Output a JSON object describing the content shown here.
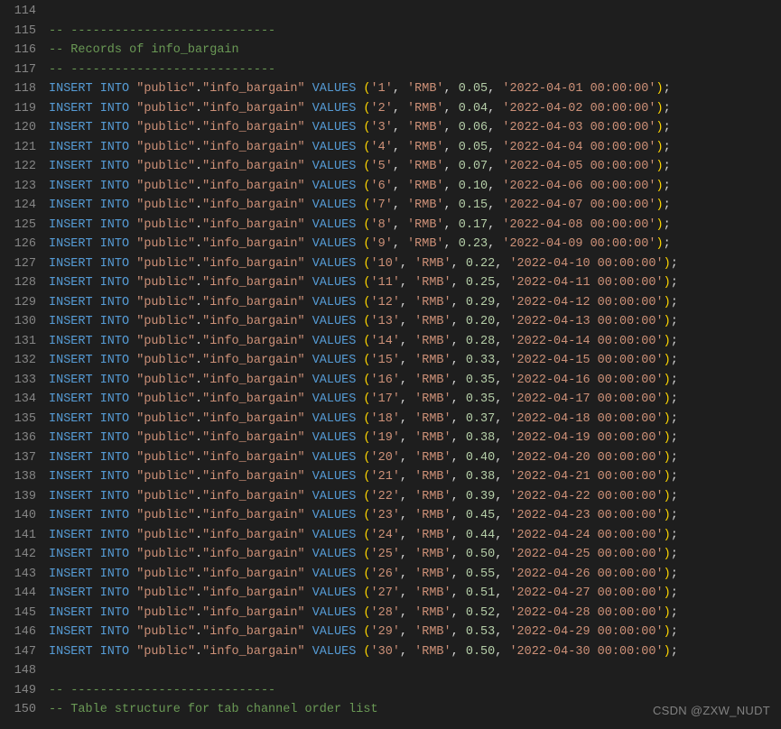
{
  "startLine": 114,
  "dashes": "-- ----------------------------",
  "header": "-- Records of info_bargain",
  "footerDashes": "-- ----------------------------",
  "footer": "-- Table structure for tab channel order list",
  "insert": "INSERT INTO",
  "values": "VALUES",
  "schema": "\"public\"",
  "table": "\"info_bargain\"",
  "rows": [
    {
      "id": "'1'",
      "cur": "'RMB'",
      "val": "0.05",
      "ts": "'2022-04-01 00:00:00'"
    },
    {
      "id": "'2'",
      "cur": "'RMB'",
      "val": "0.04",
      "ts": "'2022-04-02 00:00:00'"
    },
    {
      "id": "'3'",
      "cur": "'RMB'",
      "val": "0.06",
      "ts": "'2022-04-03 00:00:00'"
    },
    {
      "id": "'4'",
      "cur": "'RMB'",
      "val": "0.05",
      "ts": "'2022-04-04 00:00:00'"
    },
    {
      "id": "'5'",
      "cur": "'RMB'",
      "val": "0.07",
      "ts": "'2022-04-05 00:00:00'"
    },
    {
      "id": "'6'",
      "cur": "'RMB'",
      "val": "0.10",
      "ts": "'2022-04-06 00:00:00'"
    },
    {
      "id": "'7'",
      "cur": "'RMB'",
      "val": "0.15",
      "ts": "'2022-04-07 00:00:00'"
    },
    {
      "id": "'8'",
      "cur": "'RMB'",
      "val": "0.17",
      "ts": "'2022-04-08 00:00:00'"
    },
    {
      "id": "'9'",
      "cur": "'RMB'",
      "val": "0.23",
      "ts": "'2022-04-09 00:00:00'"
    },
    {
      "id": "'10'",
      "cur": "'RMB'",
      "val": "0.22",
      "ts": "'2022-04-10 00:00:00'"
    },
    {
      "id": "'11'",
      "cur": "'RMB'",
      "val": "0.25",
      "ts": "'2022-04-11 00:00:00'"
    },
    {
      "id": "'12'",
      "cur": "'RMB'",
      "val": "0.29",
      "ts": "'2022-04-12 00:00:00'"
    },
    {
      "id": "'13'",
      "cur": "'RMB'",
      "val": "0.20",
      "ts": "'2022-04-13 00:00:00'"
    },
    {
      "id": "'14'",
      "cur": "'RMB'",
      "val": "0.28",
      "ts": "'2022-04-14 00:00:00'"
    },
    {
      "id": "'15'",
      "cur": "'RMB'",
      "val": "0.33",
      "ts": "'2022-04-15 00:00:00'"
    },
    {
      "id": "'16'",
      "cur": "'RMB'",
      "val": "0.35",
      "ts": "'2022-04-16 00:00:00'"
    },
    {
      "id": "'17'",
      "cur": "'RMB'",
      "val": "0.35",
      "ts": "'2022-04-17 00:00:00'"
    },
    {
      "id": "'18'",
      "cur": "'RMB'",
      "val": "0.37",
      "ts": "'2022-04-18 00:00:00'"
    },
    {
      "id": "'19'",
      "cur": "'RMB'",
      "val": "0.38",
      "ts": "'2022-04-19 00:00:00'"
    },
    {
      "id": "'20'",
      "cur": "'RMB'",
      "val": "0.40",
      "ts": "'2022-04-20 00:00:00'"
    },
    {
      "id": "'21'",
      "cur": "'RMB'",
      "val": "0.38",
      "ts": "'2022-04-21 00:00:00'"
    },
    {
      "id": "'22'",
      "cur": "'RMB'",
      "val": "0.39",
      "ts": "'2022-04-22 00:00:00'"
    },
    {
      "id": "'23'",
      "cur": "'RMB'",
      "val": "0.45",
      "ts": "'2022-04-23 00:00:00'"
    },
    {
      "id": "'24'",
      "cur": "'RMB'",
      "val": "0.44",
      "ts": "'2022-04-24 00:00:00'"
    },
    {
      "id": "'25'",
      "cur": "'RMB'",
      "val": "0.50",
      "ts": "'2022-04-25 00:00:00'"
    },
    {
      "id": "'26'",
      "cur": "'RMB'",
      "val": "0.55",
      "ts": "'2022-04-26 00:00:00'"
    },
    {
      "id": "'27'",
      "cur": "'RMB'",
      "val": "0.51",
      "ts": "'2022-04-27 00:00:00'"
    },
    {
      "id": "'28'",
      "cur": "'RMB'",
      "val": "0.52",
      "ts": "'2022-04-28 00:00:00'"
    },
    {
      "id": "'29'",
      "cur": "'RMB'",
      "val": "0.53",
      "ts": "'2022-04-29 00:00:00'"
    },
    {
      "id": "'30'",
      "cur": "'RMB'",
      "val": "0.50",
      "ts": "'2022-04-30 00:00:00'"
    }
  ],
  "watermark": "CSDN @ZXW_NUDT"
}
